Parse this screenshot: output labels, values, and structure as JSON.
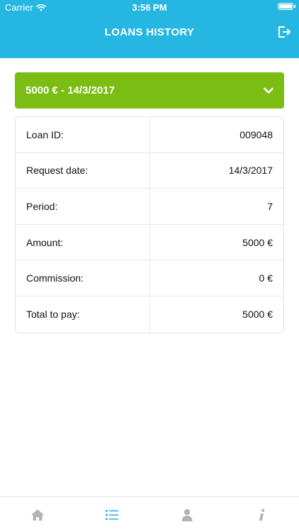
{
  "status_bar": {
    "carrier": "Carrier",
    "time": "3:56 PM"
  },
  "nav": {
    "title": "LOANS HISTORY",
    "logout_icon": "logout-icon"
  },
  "loan": {
    "header": "5000 € - 14/3/2017",
    "expand_icon": "chevron-down-icon",
    "details": [
      {
        "label": "Loan ID:",
        "value": "009048"
      },
      {
        "label": "Request date:",
        "value": "14/3/2017"
      },
      {
        "label": "Period:",
        "value": "7"
      },
      {
        "label": "Amount:",
        "value": "5000 €"
      },
      {
        "label": "Commission:",
        "value": "0 €"
      },
      {
        "label": "Total to pay:",
        "value": "5000 €"
      }
    ]
  },
  "tabbar": {
    "tabs": [
      {
        "icon": "home-icon",
        "active": false
      },
      {
        "icon": "list-icon",
        "active": true
      },
      {
        "icon": "user-icon",
        "active": false
      },
      {
        "icon": "info-icon",
        "active": false
      }
    ]
  },
  "colors": {
    "primary": "#25b7e1",
    "accent_green": "#7bbd12",
    "inactive_icon": "#b3b3b3"
  }
}
